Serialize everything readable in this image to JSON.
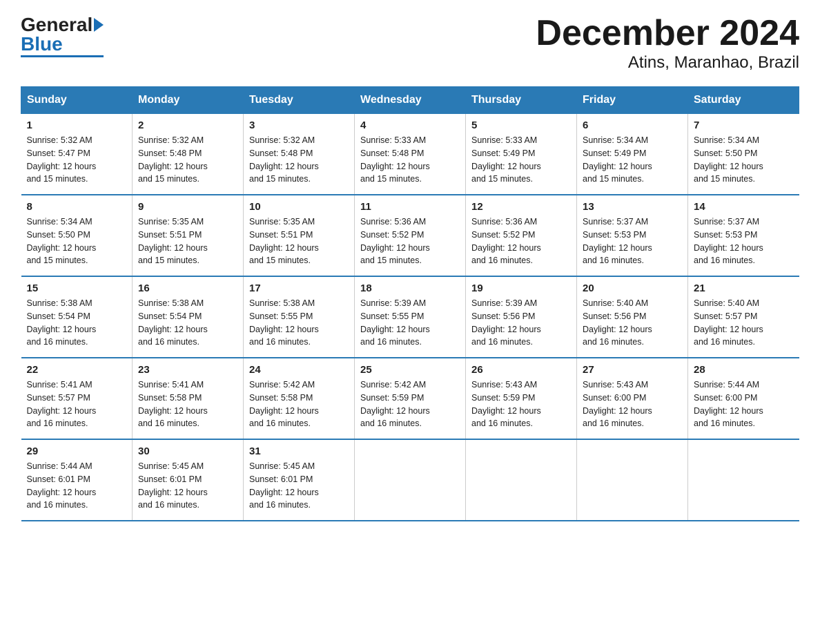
{
  "header": {
    "logo_general": "General",
    "logo_blue": "Blue",
    "title": "December 2024",
    "subtitle": "Atins, Maranhao, Brazil"
  },
  "calendar": {
    "days_of_week": [
      "Sunday",
      "Monday",
      "Tuesday",
      "Wednesday",
      "Thursday",
      "Friday",
      "Saturday"
    ],
    "weeks": [
      [
        {
          "day": "1",
          "sunrise": "5:32 AM",
          "sunset": "5:47 PM",
          "daylight": "12 hours and 15 minutes."
        },
        {
          "day": "2",
          "sunrise": "5:32 AM",
          "sunset": "5:48 PM",
          "daylight": "12 hours and 15 minutes."
        },
        {
          "day": "3",
          "sunrise": "5:32 AM",
          "sunset": "5:48 PM",
          "daylight": "12 hours and 15 minutes."
        },
        {
          "day": "4",
          "sunrise": "5:33 AM",
          "sunset": "5:48 PM",
          "daylight": "12 hours and 15 minutes."
        },
        {
          "day": "5",
          "sunrise": "5:33 AM",
          "sunset": "5:49 PM",
          "daylight": "12 hours and 15 minutes."
        },
        {
          "day": "6",
          "sunrise": "5:34 AM",
          "sunset": "5:49 PM",
          "daylight": "12 hours and 15 minutes."
        },
        {
          "day": "7",
          "sunrise": "5:34 AM",
          "sunset": "5:50 PM",
          "daylight": "12 hours and 15 minutes."
        }
      ],
      [
        {
          "day": "8",
          "sunrise": "5:34 AM",
          "sunset": "5:50 PM",
          "daylight": "12 hours and 15 minutes."
        },
        {
          "day": "9",
          "sunrise": "5:35 AM",
          "sunset": "5:51 PM",
          "daylight": "12 hours and 15 minutes."
        },
        {
          "day": "10",
          "sunrise": "5:35 AM",
          "sunset": "5:51 PM",
          "daylight": "12 hours and 15 minutes."
        },
        {
          "day": "11",
          "sunrise": "5:36 AM",
          "sunset": "5:52 PM",
          "daylight": "12 hours and 15 minutes."
        },
        {
          "day": "12",
          "sunrise": "5:36 AM",
          "sunset": "5:52 PM",
          "daylight": "12 hours and 16 minutes."
        },
        {
          "day": "13",
          "sunrise": "5:37 AM",
          "sunset": "5:53 PM",
          "daylight": "12 hours and 16 minutes."
        },
        {
          "day": "14",
          "sunrise": "5:37 AM",
          "sunset": "5:53 PM",
          "daylight": "12 hours and 16 minutes."
        }
      ],
      [
        {
          "day": "15",
          "sunrise": "5:38 AM",
          "sunset": "5:54 PM",
          "daylight": "12 hours and 16 minutes."
        },
        {
          "day": "16",
          "sunrise": "5:38 AM",
          "sunset": "5:54 PM",
          "daylight": "12 hours and 16 minutes."
        },
        {
          "day": "17",
          "sunrise": "5:38 AM",
          "sunset": "5:55 PM",
          "daylight": "12 hours and 16 minutes."
        },
        {
          "day": "18",
          "sunrise": "5:39 AM",
          "sunset": "5:55 PM",
          "daylight": "12 hours and 16 minutes."
        },
        {
          "day": "19",
          "sunrise": "5:39 AM",
          "sunset": "5:56 PM",
          "daylight": "12 hours and 16 minutes."
        },
        {
          "day": "20",
          "sunrise": "5:40 AM",
          "sunset": "5:56 PM",
          "daylight": "12 hours and 16 minutes."
        },
        {
          "day": "21",
          "sunrise": "5:40 AM",
          "sunset": "5:57 PM",
          "daylight": "12 hours and 16 minutes."
        }
      ],
      [
        {
          "day": "22",
          "sunrise": "5:41 AM",
          "sunset": "5:57 PM",
          "daylight": "12 hours and 16 minutes."
        },
        {
          "day": "23",
          "sunrise": "5:41 AM",
          "sunset": "5:58 PM",
          "daylight": "12 hours and 16 minutes."
        },
        {
          "day": "24",
          "sunrise": "5:42 AM",
          "sunset": "5:58 PM",
          "daylight": "12 hours and 16 minutes."
        },
        {
          "day": "25",
          "sunrise": "5:42 AM",
          "sunset": "5:59 PM",
          "daylight": "12 hours and 16 minutes."
        },
        {
          "day": "26",
          "sunrise": "5:43 AM",
          "sunset": "5:59 PM",
          "daylight": "12 hours and 16 minutes."
        },
        {
          "day": "27",
          "sunrise": "5:43 AM",
          "sunset": "6:00 PM",
          "daylight": "12 hours and 16 minutes."
        },
        {
          "day": "28",
          "sunrise": "5:44 AM",
          "sunset": "6:00 PM",
          "daylight": "12 hours and 16 minutes."
        }
      ],
      [
        {
          "day": "29",
          "sunrise": "5:44 AM",
          "sunset": "6:01 PM",
          "daylight": "12 hours and 16 minutes."
        },
        {
          "day": "30",
          "sunrise": "5:45 AM",
          "sunset": "6:01 PM",
          "daylight": "12 hours and 16 minutes."
        },
        {
          "day": "31",
          "sunrise": "5:45 AM",
          "sunset": "6:01 PM",
          "daylight": "12 hours and 16 minutes."
        },
        null,
        null,
        null,
        null
      ]
    ],
    "labels": {
      "sunrise": "Sunrise:",
      "sunset": "Sunset:",
      "daylight": "Daylight:"
    }
  }
}
